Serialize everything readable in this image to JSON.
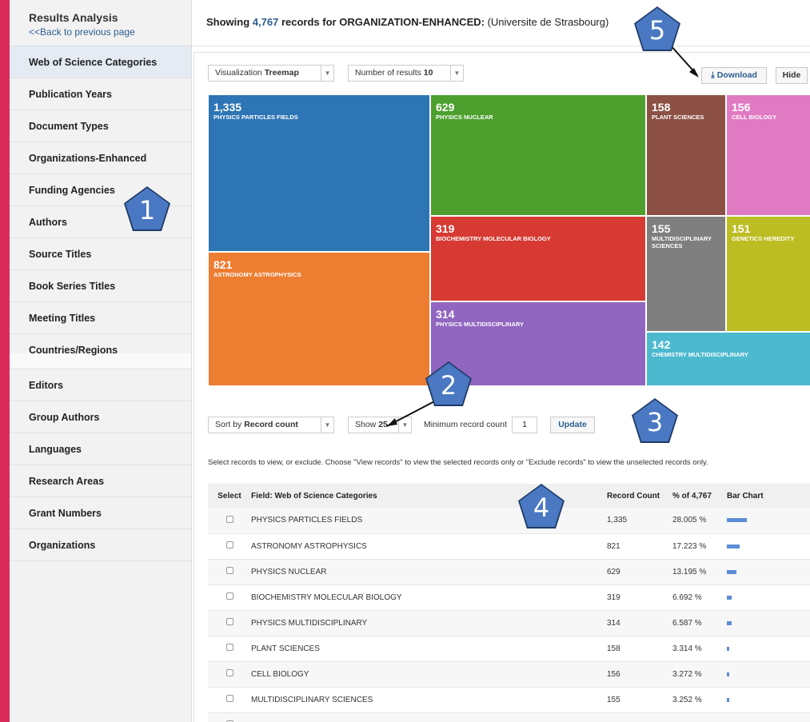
{
  "sidebar": {
    "title": "Results Analysis",
    "back": "<<Back to previous page",
    "items": [
      "Web of Science Categories",
      "Publication Years",
      "Document Types",
      "Organizations-Enhanced",
      "Funding Agencies",
      "Authors",
      "Source Titles",
      "Book Series Titles",
      "Meeting Titles",
      "Countries/Regions",
      "Editors",
      "Group Authors",
      "Languages",
      "Research Areas",
      "Grant Numbers",
      "Organizations"
    ]
  },
  "header": {
    "prefix": "Showing",
    "count": "4,767",
    "mid": "records for ORGANIZATION-ENHANCED:",
    "org": "(Universite de Strasbourg)"
  },
  "controls": {
    "visualization_label": "Visualization",
    "visualization_value": "Treemap",
    "results_label": "Number of results",
    "results_value": "10",
    "download": "Download",
    "download_glyph": "⤓",
    "hide": "Hide",
    "sort_label": "Sort by",
    "sort_value": "Record count",
    "show_label": "Show",
    "show_value": "25",
    "min_label": "Minimum record count",
    "min_value": "1",
    "update": "Update",
    "note": "Select records to view, or exclude. Choose \"View records\" to view the selected records only or \"Exclude records\" to view the unselected records only."
  },
  "treemap": [
    {
      "value": "1,335",
      "label": "PHYSICS PARTICLES FIELDS",
      "color": "#2e75b6"
    },
    {
      "value": "821",
      "label": "ASTRONOMY ASTROPHYSICS",
      "color": "#ed7d31"
    },
    {
      "value": "629",
      "label": "PHYSICS NUCLEAR",
      "color": "#4ea02e"
    },
    {
      "value": "319",
      "label": "BIOCHEMISTRY MOLECULAR BIOLOGY",
      "color": "#d63a32"
    },
    {
      "value": "314",
      "label": "PHYSICS MULTIDISCIPLINARY",
      "color": "#9166c0"
    },
    {
      "value": "158",
      "label": "PLANT SCIENCES",
      "color": "#8c5144"
    },
    {
      "value": "156",
      "label": "CELL BIOLOGY",
      "color": "#e07ac2"
    },
    {
      "value": "155",
      "label": "MULTIDISCIPLINARY SCIENCES",
      "color": "#7f7f7f"
    },
    {
      "value": "151",
      "label": "GENETICS HEREDITY",
      "color": "#bcbd22"
    },
    {
      "value": "142",
      "label": "CHEMISTRY MULTIDISCIPLINARY",
      "color": "#4cb9cf"
    }
  ],
  "table": {
    "headers": [
      "Select",
      "Field: Web of Science Categories",
      "Record Count",
      "% of 4,767",
      "Bar Chart"
    ],
    "rows": [
      {
        "field": "PHYSICS PARTICLES FIELDS",
        "count": "1,335",
        "pct": "28.005 %",
        "share": 0.28005
      },
      {
        "field": "ASTRONOMY ASTROPHYSICS",
        "count": "821",
        "pct": "17.223 %",
        "share": 0.17223
      },
      {
        "field": "PHYSICS NUCLEAR",
        "count": "629",
        "pct": "13.195 %",
        "share": 0.13195
      },
      {
        "field": "BIOCHEMISTRY MOLECULAR BIOLOGY",
        "count": "319",
        "pct": "6.692 %",
        "share": 0.06692
      },
      {
        "field": "PHYSICS MULTIDISCIPLINARY",
        "count": "314",
        "pct": "6.587 %",
        "share": 0.06587
      },
      {
        "field": "PLANT SCIENCES",
        "count": "158",
        "pct": "3.314 %",
        "share": 0.03314
      },
      {
        "field": "CELL BIOLOGY",
        "count": "156",
        "pct": "3.272 %",
        "share": 0.03272
      },
      {
        "field": "MULTIDISCIPLINARY SCIENCES",
        "count": "155",
        "pct": "3.252 %",
        "share": 0.03252
      },
      {
        "field": "GENETICS HEREDITY",
        "count": "151",
        "pct": "3.168 %",
        "share": 0.03168
      }
    ]
  },
  "callouts": [
    "1",
    "2",
    "3",
    "4",
    "5"
  ]
}
